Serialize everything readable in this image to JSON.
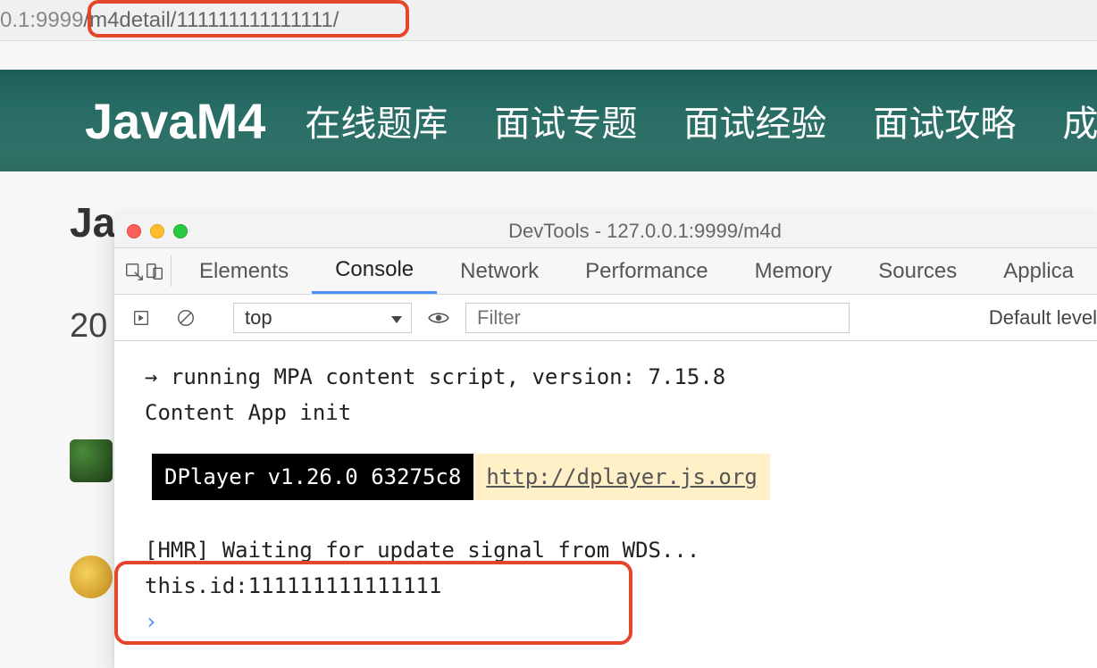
{
  "address_bar": {
    "host_port": "0.1:9999",
    "path": "/m4detail/111111111111111/"
  },
  "nav": {
    "brand": "JavaM4",
    "items": [
      "在线题库",
      "面试专题",
      "面试经验",
      "面试攻略",
      "成"
    ]
  },
  "page_behind": {
    "title_fragment": "Ja",
    "sub_fragment": "20"
  },
  "devtools": {
    "window_title": "DevTools - 127.0.0.1:9999/m4d",
    "tabs": [
      "Elements",
      "Console",
      "Network",
      "Performance",
      "Memory",
      "Sources",
      "Applica"
    ],
    "active_tab": "Console",
    "context": "top",
    "filter_placeholder": "Filter",
    "levels_label": "Default level",
    "console": {
      "line1": "→ running MPA content script, version: 7.15.8",
      "line2": "Content App init",
      "dplayer_badge": "DPlayer v1.26.0 63275c8",
      "dplayer_url": "http://dplayer.js.org",
      "line3": "[HMR] Waiting for update signal from WDS...",
      "line4": "this.id:111111111111111"
    }
  }
}
